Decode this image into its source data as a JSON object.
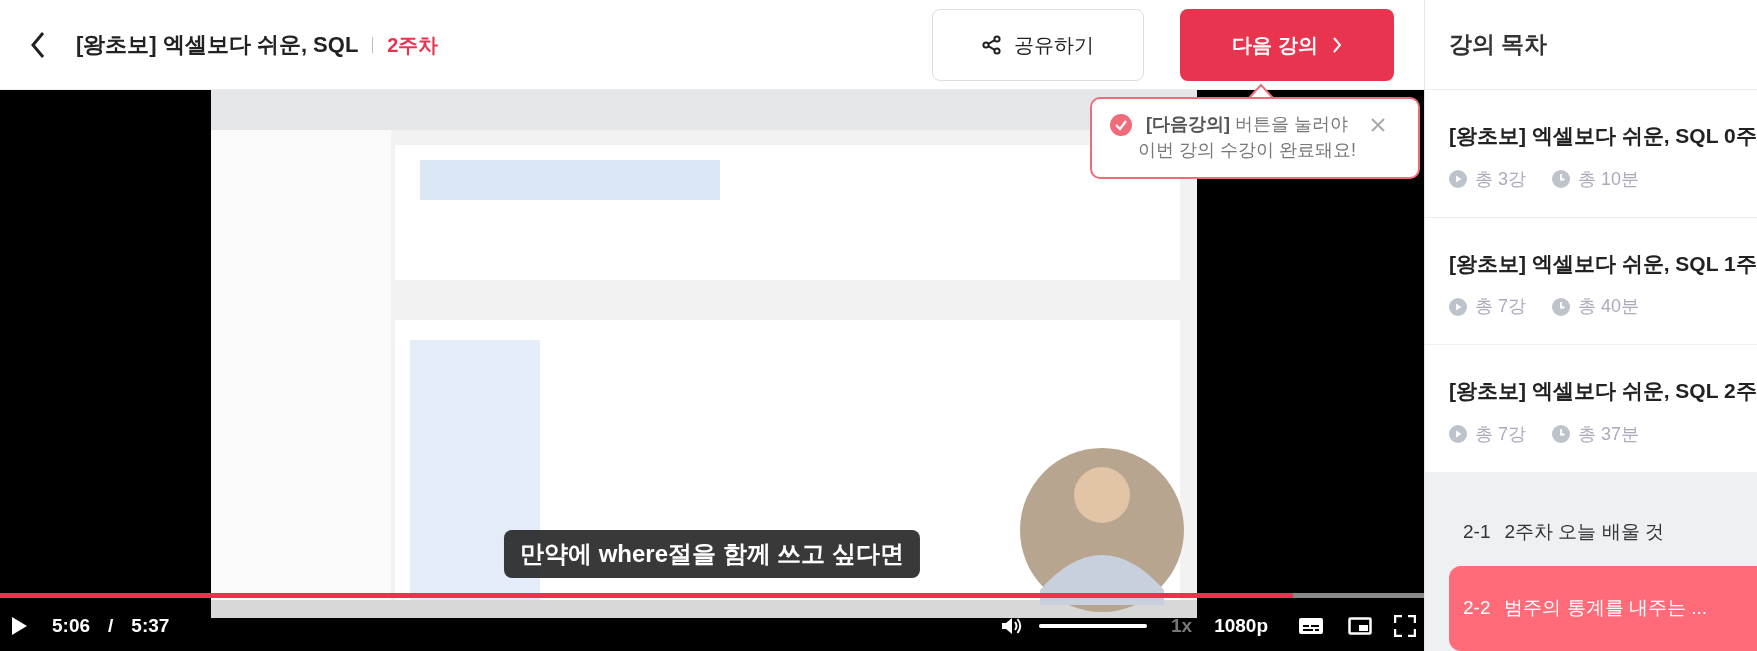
{
  "header": {
    "title": "[왕초보] 엑셀보다 쉬운, SQL",
    "week": "2주차",
    "share_button": "공유하기",
    "next_button": "다음 강의"
  },
  "tooltip": {
    "text": "**[다음강의]** 버튼을 눌러야 이번 강의 수강이 완료돼요!"
  },
  "video": {
    "subtitle": "만약에 where절을 함께 쓰고 싶다면"
  },
  "player": {
    "current_time": "5:06",
    "separator": "/",
    "duration": "5:37",
    "level": 0.908,
    "volume": {
      "level": 1.0
    },
    "speed": "1x",
    "quality": "1080p"
  },
  "sidebar": {
    "title": "강의 목차",
    "weeks": [
      {
        "title": "[왕초보] 엑셀보다 쉬운, SQL 0주",
        "lessons_count": "총 3강",
        "total_time": "총 10분"
      },
      {
        "title": "[왕초보] 엑셀보다 쉬운, SQL 1주",
        "lessons_count": "총 7강",
        "total_time": "총 40분"
      },
      {
        "title": "[왕초보] 엑셀보다 쉬운, SQL 2주",
        "lessons_count": "총 7강",
        "total_time": "총 37분",
        "lessons": [
          {
            "number": "2-1",
            "title": "2주차 오늘 배울 것",
            "selected": false
          },
          {
            "number": "2-2",
            "title": "범주의 통계를 내주는 ...",
            "selected": true
          }
        ]
      }
    ]
  }
}
